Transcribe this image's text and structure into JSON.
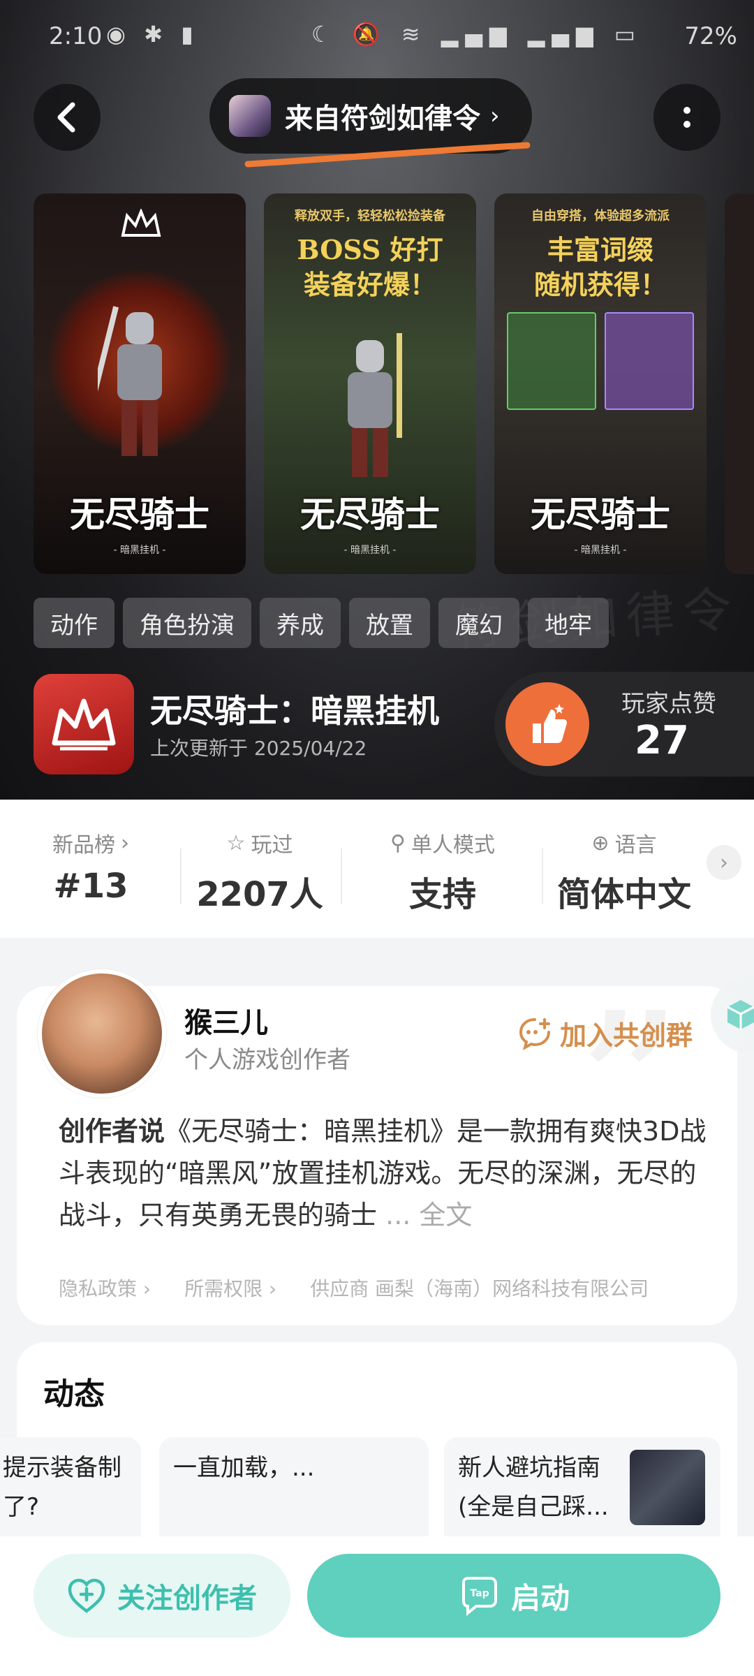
{
  "status": {
    "time": "2:10",
    "battery": "72%",
    "network_1": "46",
    "network_2": "5G"
  },
  "header": {
    "source_label": "来自符剑如律令",
    "accent_underline_color": "#ef7a34"
  },
  "screenshots": [
    {
      "logo": "无尽骑士",
      "sub": "- 暗黑挂机 -"
    },
    {
      "small": "释放双手，轻轻松松捡装备",
      "big1": "BOSS 好打",
      "big2": "装备好爆！",
      "logo": "无尽骑士",
      "sub": "- 暗黑挂机 -"
    },
    {
      "small": "自由穿搭，体验超多流派",
      "big1": "丰富词缀",
      "big2": "随机获得！",
      "logo": "无尽骑士",
      "sub": "- 暗黑挂机 -"
    }
  ],
  "tags": [
    "动作",
    "角色扮演",
    "养成",
    "放置",
    "魔幻",
    "地牢"
  ],
  "game": {
    "title": "无尽骑士：暗黑挂机",
    "updated": "上次更新于 2025/04/22",
    "like_label": "玩家点赞",
    "like_count": "27"
  },
  "stats": [
    {
      "label": "新品榜",
      "value": "#13"
    },
    {
      "label": "玩过",
      "value": "2207人"
    },
    {
      "label": "单人模式",
      "value": "支持"
    },
    {
      "label": "语言",
      "value": "简体中文"
    }
  ],
  "creator": {
    "name": "猴三儿",
    "role": "个人游戏创作者",
    "join_group": "加入共创群",
    "desc_lead": "创作者说",
    "desc_body": "《无尽骑士：暗黑挂机》是一款拥有爽快3D战斗表现的“暗黑风”放置挂机游戏。无尽的深渊，无尽的战斗，只有英勇无畏的骑士",
    "desc_more": "... 全文",
    "privacy": "隐私政策",
    "permissions": "所需权限",
    "supplier": "供应商 画梨（海南）网络科技有限公司"
  },
  "dynamics": {
    "title": "动态",
    "posts": [
      {
        "text": "提示装备制了?"
      },
      {
        "text": "一直加载，..."
      },
      {
        "text": "新人避坑指南(全是自己踩..."
      }
    ]
  },
  "bottom": {
    "follow": "关注创作者",
    "start": "启动",
    "accent": "#5fcfbe"
  }
}
